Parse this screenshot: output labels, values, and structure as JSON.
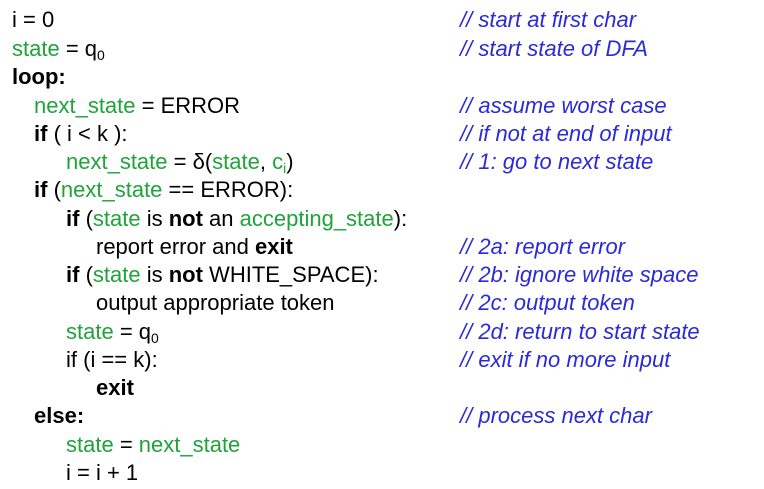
{
  "colors": {
    "text": "#000000",
    "highlight": "#1fa33a",
    "comment": "#2a2ad8"
  },
  "t": {
    "i_eq_0": "i = 0",
    "state": "state",
    "eq_q": " = q",
    "zero": "0",
    "loop": "loop:",
    "next_state": "next_state",
    "eq_error": " = ERROR",
    "if": "if",
    "i_lt_k": " ( i < k ):",
    "eq_delta": " = δ(",
    "comma_sp": ", ",
    "c": "c",
    "i": "i",
    "close_paren": ")",
    "open_paren": " (",
    "eq_eq_error": " == ERROR):",
    "is_sp": " is ",
    "not": "not",
    "an_sp": " an ",
    "accepting_state": "accepting_state",
    "colon_paren": "):",
    "report_error_and": "report error and ",
    "exit": "exit",
    "white_space": " WHITE_SPACE):",
    "output_token": "output appropriate token",
    "if_i_eq_k": "if (i == k):",
    "else": "else:",
    "eq_sp": " = ",
    "i_incr": "i = i + 1"
  },
  "comments": {
    "start_first": "// start at first char",
    "start_dfa": "// start state of DFA",
    "assume_worst": "// assume worst case",
    "not_end": "// if not at end of input",
    "c1": "//  1: go to next state",
    "c2a": "//  2a: report error",
    "c2b": "//  2b: ignore white space",
    "c2c": "//  2c: output token",
    "c2d": "//  2d: return to start state",
    "exit_more": "//  exit if no more input",
    "process_next": "//  process next char"
  }
}
